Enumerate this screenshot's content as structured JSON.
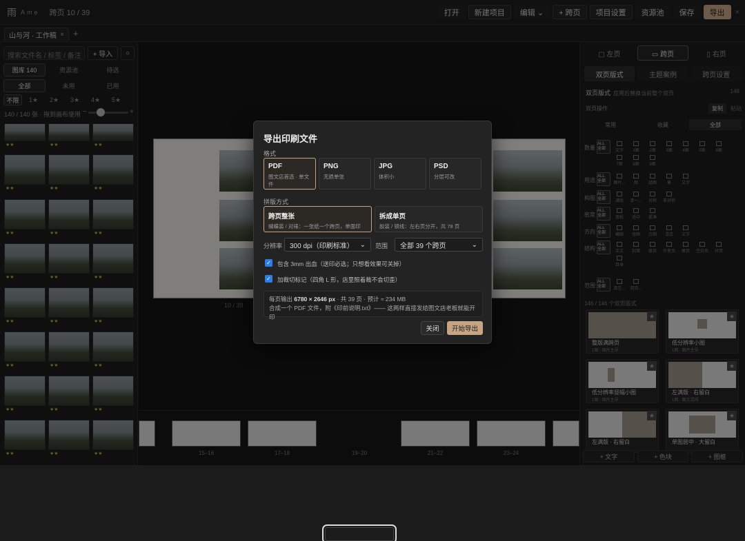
{
  "topbar": {
    "logo": "雨",
    "logo_sub": "Ame",
    "info": "跨页 10 / 39",
    "buttons": [
      "打开",
      "新建项目",
      "编辑 ⌄",
      "+ 跨页",
      "项目设置",
      "资源池",
      "保存",
      "导出"
    ],
    "close": "×"
  },
  "tabs": {
    "active": "山与河 · 工作稿",
    "close": "×",
    "add": "+"
  },
  "left": {
    "search_placeholder": "搜索文件名 / 标签 / 备注",
    "import_label": "+ 导入",
    "refresh_icon": "○",
    "seg1": [
      "图库 140",
      "资源池",
      "待选"
    ],
    "seg2": [
      "全部",
      "未用",
      "已用"
    ],
    "seg3": [
      "不限",
      "1★",
      "2★",
      "3★",
      "4★",
      "5★"
    ],
    "count": "140 / 140 张 · 拖到画布使用",
    "minus": "−",
    "plus": "+",
    "stars": "★★"
  },
  "canvas": {
    "page_label": "10 / 39"
  },
  "filmstrip": {
    "labels": [
      "15–16",
      "17–18",
      "19–20",
      "21–22",
      "23–24"
    ]
  },
  "right": {
    "tabs": [
      "▢ 左页",
      "▭ 跨页",
      "▯ 右页"
    ],
    "subtabs": [
      "双页版式",
      "主题案例",
      "跨页设置"
    ],
    "title": "双页版式",
    "title_note": "应用后替换当前整个双页",
    "count": "146",
    "op_label": "双页操作",
    "op_copy": "复制",
    "op_paste": "粘贴",
    "cats": [
      "常用",
      "收藏",
      "全部"
    ],
    "filters": [
      "数量",
      "用途",
      "构图",
      "密度",
      "方向",
      "结构",
      "范围"
    ],
    "all_chip": "ALL 全部",
    "qty_icons": [
      "文字",
      "1图",
      "2图",
      "3图",
      "4图",
      "5图",
      "6图",
      "7图",
      "8图",
      "9图"
    ],
    "use_icons": [
      "图片...",
      "图",
      "组图",
      "章",
      "文字"
    ],
    "comp_icons": [
      "满版",
      "单一...",
      "对称",
      "非对称"
    ],
    "dens_icons": [
      "宽松",
      "适中",
      "紧凑"
    ],
    "dir_icons": [
      "横图",
      "竖图",
      "方图",
      "混合",
      "文字"
    ],
    "struct_icons": [
      "正文",
      "封面",
      "扉页",
      "作者页",
      "尾页",
      "空白页",
      "衬页",
      "目录"
    ],
    "range_icons": [
      "真左...",
      "双页..."
    ],
    "layout_count": "146 / 146 个双页版式",
    "cards": [
      {
        "name": "整版满跨页",
        "sub": "1图 · 图片主导"
      },
      {
        "name": "低分辨率小图",
        "sub": "1图 · 图片主导"
      },
      {
        "name": "低分辨率竖幅小图",
        "sub": "1图 · 图片主导"
      },
      {
        "name": "左满版 · 右留白",
        "sub": "1图 · 图文混排"
      },
      {
        "name": "左满版 · 右留白",
        "sub": ""
      },
      {
        "name": "单图居中 · 大留白",
        "sub": ""
      }
    ],
    "star": "★",
    "add_buttons": [
      "+ 文字",
      "+ 色块",
      "+ 图框"
    ]
  },
  "modal": {
    "title": "导出印刷文件",
    "format_label": "格式",
    "formats": [
      {
        "name": "PDF",
        "desc": "图文店首选 · 单文件"
      },
      {
        "name": "PNG",
        "desc": "无损单张"
      },
      {
        "name": "JPG",
        "desc": "体积小"
      },
      {
        "name": "PSD",
        "desc": "分层可改"
      }
    ],
    "imposition_label": "拼版方式",
    "impositions": [
      {
        "name": "跨页整张",
        "desc": "蝴蝶装 / 对裱：一张纸一个跨页，单面印"
      },
      {
        "name": "拆成单页",
        "desc": "胶装 / 锁线：左右页分开，共 78 页"
      }
    ],
    "dpi_label": "分辨率",
    "dpi_value": "300 dpi（印刷标准）",
    "range_label": "范围",
    "range_value": "全部 39 个跨页",
    "check1": "包含 3mm 出血（送印必选；只想看效果可关掉）",
    "check2": "加裁切标记（四角 L 形，店里照着裁不会切歪）",
    "info_line1_prefix": "每页输出 ",
    "info_line1_bold": "6780 × 2646 px",
    "info_line1_suffix": " · 共 39 页 · 预计 ≈ 234 MB",
    "info_line2": "合成一个 PDF 文件，附《印前说明.txt》—— 这两样直接发给图文店老板就能开印",
    "close": "关闭",
    "start": "开始导出",
    "chevron": "⌄"
  }
}
